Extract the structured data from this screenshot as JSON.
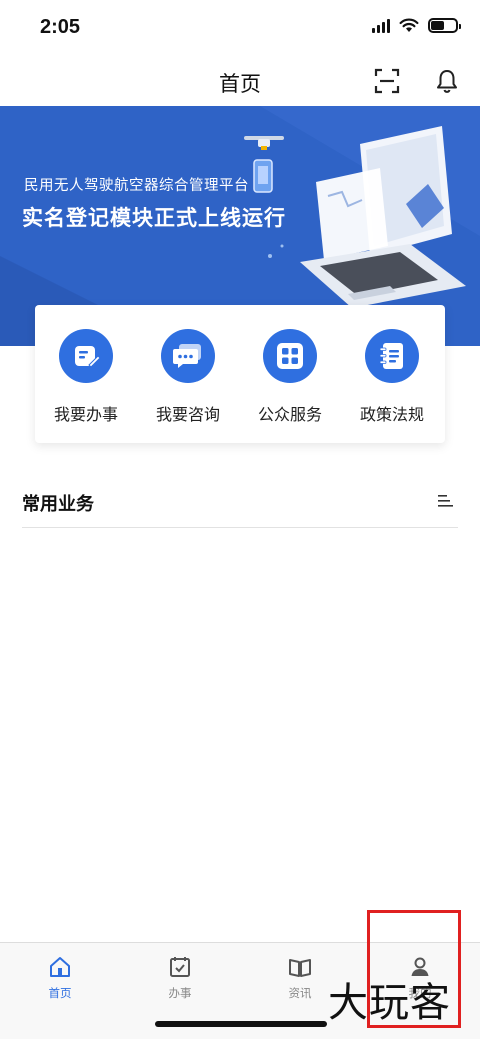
{
  "status_bar": {
    "time": "2:05"
  },
  "header": {
    "title": "首页"
  },
  "banner": {
    "subtitle": "民用无人驾驶航空器综合管理平台",
    "title": "实名登记模块正式上线运行"
  },
  "quick_actions": [
    {
      "label": "我要办事",
      "icon": "edit-document-icon"
    },
    {
      "label": "我要咨询",
      "icon": "chat-bubble-icon"
    },
    {
      "label": "公众服务",
      "icon": "grid-icon"
    },
    {
      "label": "政策法规",
      "icon": "notebook-icon"
    }
  ],
  "common_business": {
    "title": "常用业务"
  },
  "tabs": [
    {
      "label": "首页",
      "icon": "home-icon",
      "active": true
    },
    {
      "label": "办事",
      "icon": "calendar-check-icon",
      "active": false
    },
    {
      "label": "资讯",
      "icon": "book-icon",
      "active": false
    },
    {
      "label": "我的",
      "icon": "person-icon",
      "active": false
    }
  ],
  "watermark": "大玩客",
  "colors": {
    "accent": "#2f6fe0",
    "banner": "#2f63c6",
    "highlight_box": "#e02020"
  }
}
